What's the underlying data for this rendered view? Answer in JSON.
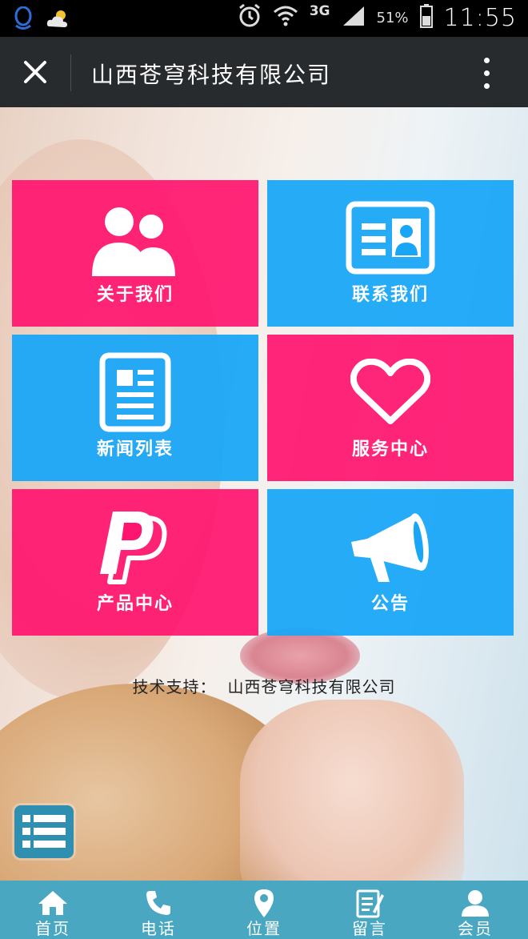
{
  "status_bar": {
    "network": "3G",
    "battery": "51%",
    "time": "11:55",
    "icons": [
      "qq-icon",
      "weather-icon",
      "alarm-icon",
      "wifi-icon",
      "signal-icon",
      "battery-icon"
    ]
  },
  "title_bar": {
    "title": "山西苍穹科技有限公司",
    "close_icon": "close-icon",
    "more_icon": "more-vertical-icon"
  },
  "tiles": [
    {
      "label": "关于我们",
      "icon": "users-icon",
      "color": "#ff156f"
    },
    {
      "label": "联系我们",
      "icon": "contact-card-icon",
      "color": "#1aa6f7"
    },
    {
      "label": "新闻列表",
      "icon": "news-icon",
      "color": "#1aa6f7"
    },
    {
      "label": "服务中心",
      "icon": "heart-icon",
      "color": "#ff156f"
    },
    {
      "label": "产品中心",
      "icon": "paypal-icon",
      "color": "#ff156f"
    },
    {
      "label": "公告",
      "icon": "megaphone-icon",
      "color": "#1aa6f7"
    }
  ],
  "support": {
    "prefix": "技术支持：",
    "company": "山西苍穹科技有限公司"
  },
  "menu_button_icon": "list-icon",
  "bottom_nav": [
    {
      "label": "首页",
      "icon": "home-icon"
    },
    {
      "label": "电话",
      "icon": "phone-icon"
    },
    {
      "label": "位置",
      "icon": "location-icon"
    },
    {
      "label": "留言",
      "icon": "message-icon"
    },
    {
      "label": "会员",
      "icon": "member-icon"
    }
  ],
  "colors": {
    "pink": "#ff156f",
    "blue": "#1aa6f7",
    "nav": "#4aa7c2",
    "titlebar": "#272b2e"
  }
}
